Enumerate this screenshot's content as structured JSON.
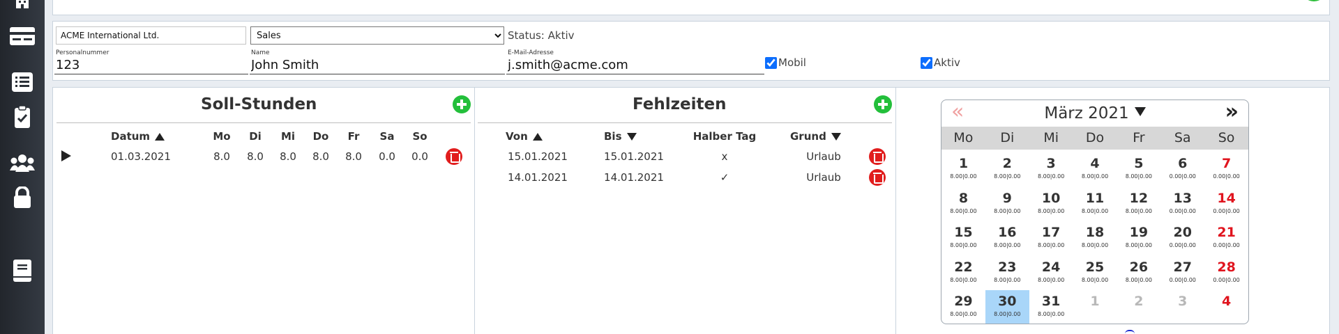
{
  "sidebar": {
    "items": [
      {
        "icon": "building-icon"
      },
      {
        "icon": "id-card-icon"
      },
      {
        "icon": "list-icon"
      },
      {
        "icon": "clipboard-check-icon"
      },
      {
        "icon": "users-icon"
      },
      {
        "icon": "lock-icon"
      },
      {
        "icon": "book-icon"
      }
    ]
  },
  "employee": {
    "company": "ACME International Ltd.",
    "department": "Sales",
    "status_text": "Status: Aktiv",
    "personnel_label": "Personalnummer",
    "personnel_value": "123",
    "name_label": "Name",
    "name_value": "John Smith",
    "email_label": "E-Mail-Adresse",
    "email_value": "j.smith@acme.com",
    "mobile_label": "Mobil",
    "mobile_checked": true,
    "active_label": "Aktiv",
    "active_checked": true
  },
  "soll": {
    "title": "Soll-Stunden",
    "columns": [
      "Datum",
      "Mo",
      "Di",
      "Mi",
      "Do",
      "Fr",
      "Sa",
      "So"
    ],
    "rows": [
      {
        "datum": "01.03.2021",
        "mo": "8.0",
        "di": "8.0",
        "mi": "8.0",
        "do": "8.0",
        "fr": "8.0",
        "sa": "0.0",
        "so": "0.0"
      }
    ]
  },
  "fehl": {
    "title": "Fehlzeiten",
    "columns": [
      "Von",
      "Bis",
      "Halber Tag",
      "Grund"
    ],
    "rows": [
      {
        "von": "15.01.2021",
        "bis": "15.01.2021",
        "halb": "x",
        "grund": "Urlaub"
      },
      {
        "von": "14.01.2021",
        "bis": "14.01.2021",
        "halb": "✓",
        "grund": "Urlaub"
      }
    ]
  },
  "calendar": {
    "month_label": "März 2021",
    "prev_symbol": "«",
    "next_symbol": "»",
    "weekdays": [
      "Mo",
      "Di",
      "Mi",
      "Do",
      "Fr",
      "Sa",
      "So"
    ],
    "weeks": [
      [
        {
          "d": "1",
          "h": "8.00|0.00"
        },
        {
          "d": "2",
          "h": "8.00|0.00"
        },
        {
          "d": "3",
          "h": "8.00|0.00"
        },
        {
          "d": "4",
          "h": "8.00|0.00"
        },
        {
          "d": "5",
          "h": "8.00|0.00"
        },
        {
          "d": "6",
          "h": "0.00|0.00"
        },
        {
          "d": "7",
          "h": "0.00|0.00"
        }
      ],
      [
        {
          "d": "8",
          "h": "8.00|0.00"
        },
        {
          "d": "9",
          "h": "8.00|0.00"
        },
        {
          "d": "10",
          "h": "8.00|0.00"
        },
        {
          "d": "11",
          "h": "8.00|0.00"
        },
        {
          "d": "12",
          "h": "8.00|0.00"
        },
        {
          "d": "13",
          "h": "0.00|0.00"
        },
        {
          "d": "14",
          "h": "0.00|0.00"
        }
      ],
      [
        {
          "d": "15",
          "h": "8.00|0.00"
        },
        {
          "d": "16",
          "h": "8.00|0.00"
        },
        {
          "d": "17",
          "h": "8.00|0.00"
        },
        {
          "d": "18",
          "h": "8.00|0.00"
        },
        {
          "d": "19",
          "h": "8.00|0.00"
        },
        {
          "d": "20",
          "h": "0.00|0.00"
        },
        {
          "d": "21",
          "h": "0.00|0.00"
        }
      ],
      [
        {
          "d": "22",
          "h": "8.00|0.00"
        },
        {
          "d": "23",
          "h": "8.00|0.00"
        },
        {
          "d": "24",
          "h": "8.00|0.00"
        },
        {
          "d": "25",
          "h": "8.00|0.00"
        },
        {
          "d": "26",
          "h": "8.00|0.00"
        },
        {
          "d": "27",
          "h": "0.00|0.00"
        },
        {
          "d": "28",
          "h": "0.00|0.00"
        }
      ],
      [
        {
          "d": "29",
          "h": "8.00|0.00"
        },
        {
          "d": "30",
          "h": "8.00|0.00",
          "today": true
        },
        {
          "d": "31",
          "h": "8.00|0.00"
        },
        {
          "d": "1",
          "h": "",
          "other": true
        },
        {
          "d": "2",
          "h": "",
          "other": true
        },
        {
          "d": "3",
          "h": "",
          "other": true
        },
        {
          "d": "4",
          "h": "",
          "other": true
        }
      ]
    ]
  },
  "colors": {
    "sidebar": "#2b3037",
    "add": "#23bf3b",
    "delete": "#e11d1d",
    "sunday": "#e0141e",
    "today": "#a9d6f9",
    "weekday_header": "#d7d7d7"
  }
}
